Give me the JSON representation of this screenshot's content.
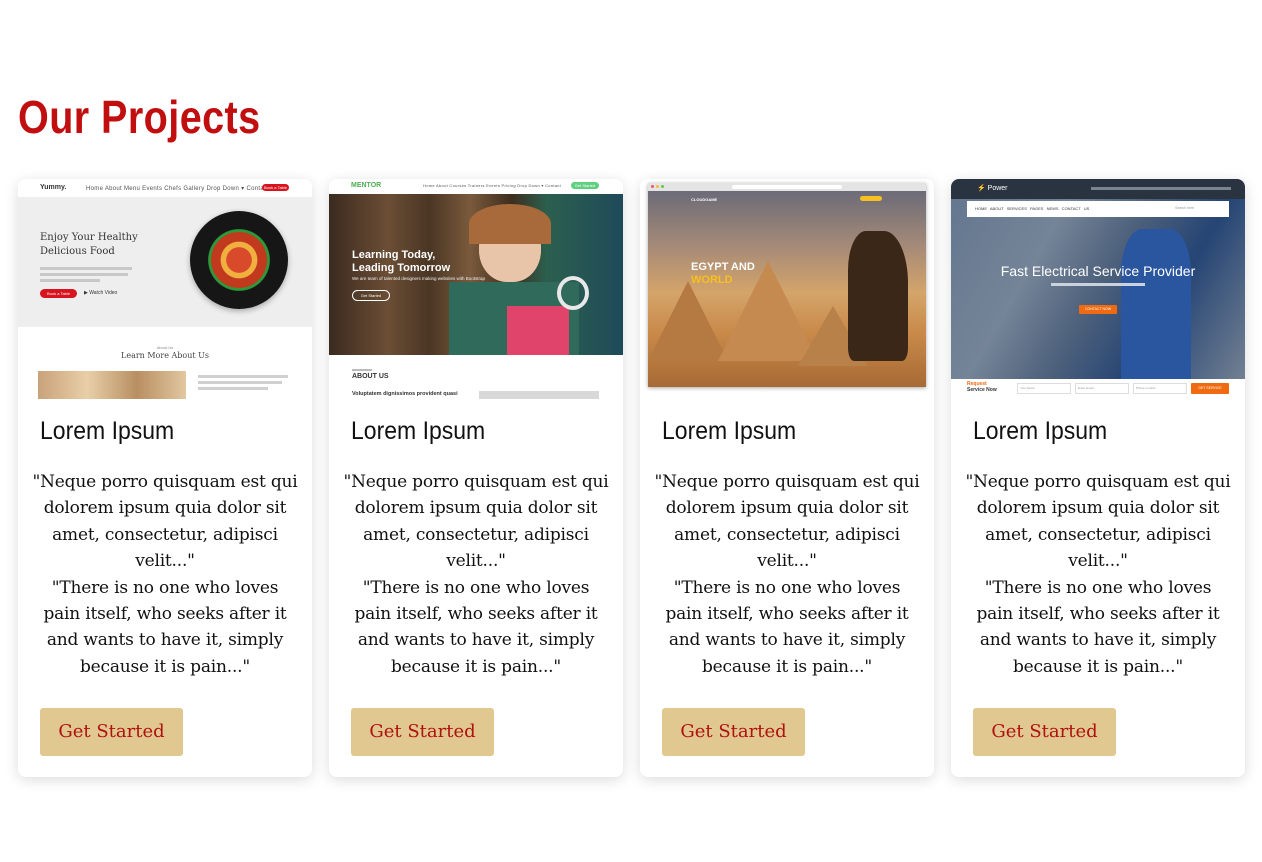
{
  "page": {
    "title": "Our Projects",
    "accent_color": "#c10f0f",
    "button_color": "#e0c890"
  },
  "projects": [
    {
      "name": "Lorem Ipsum",
      "quote_1": "\"Neque porro quisquam est qui dolorem ipsum quia dolor sit amet, consectetur, adipisci velit...\"",
      "quote_2": "\"There is no one who loves pain itself, who seeks after it and wants to have it, simply because it is pain...\"",
      "button": "Get Started",
      "preview": {
        "brand": "Yummy.",
        "nav": "Home  About  Menu  Events  Chefs  Gallery  Drop Down ▾  Contact",
        "cta": "Book a Table",
        "headline_1": "Enjoy Your Healthy",
        "headline_2": "Delicious Food",
        "book_button": "Book a Table",
        "watch": "Watch Video",
        "section_kicker": "About Us",
        "section_title": "Learn More About Us"
      }
    },
    {
      "name": "Lorem Ipsum",
      "quote_1": "\"Neque porro quisquam est qui dolorem ipsum quia dolor sit amet, consectetur, adipisci velit...\"",
      "quote_2": "\"There is no one who loves pain itself, who seeks after it and wants to have it, simply because it is pain...\"",
      "button": "Get Started",
      "preview": {
        "brand": "MENTOR",
        "nav": "Home  About  Courses  Trainers  Events  Pricing  Drop Down ▾  Contact",
        "cta": "Get Started",
        "headline_1": "Learning Today,",
        "headline_2": "Leading Tomorrow",
        "sub": "We are team of talented designers making websites with Bootstrap",
        "hero_button": "Get Started",
        "section_title": "ABOUT US",
        "section_text": "Voluptatem dignissimos provident quasi"
      }
    },
    {
      "name": "Lorem Ipsum",
      "quote_1": "\"Neque porro quisquam est qui dolorem ipsum quia dolor sit amet, consectetur, adipisci velit...\"",
      "quote_2": "\"There is no one who loves pain itself, who seeks after it and wants to have it, simply because it is pain...\"",
      "button": "Get Started",
      "preview": {
        "brand": "CLOUDGAME",
        "headline_1": "EGYPT AND",
        "headline_2": "WORLD"
      }
    },
    {
      "name": "Lorem Ipsum",
      "quote_1": "\"Neque porro quisquam est qui dolorem ipsum quia dolor sit amet, consectetur, adipisci velit...\"",
      "quote_2": "\"There is no one who loves pain itself, who seeks after it and wants to have it, simply because it is pain...\"",
      "button": "Get Started",
      "preview": {
        "brand": "Power",
        "nav": "HOME   ABOUT   SERVICES   PAGES   NEWS   CONTACT US",
        "search_placeholder": "Search here",
        "headline": "Fast Electrical Service Provider",
        "hero_button": "CONTACT NOW",
        "request_1": "Request",
        "request_2": "Service Now",
        "field_1": "Your Name",
        "field_2": "Enter Email",
        "field_3": "Phone number",
        "submit": "GET SERVICE"
      }
    }
  ]
}
